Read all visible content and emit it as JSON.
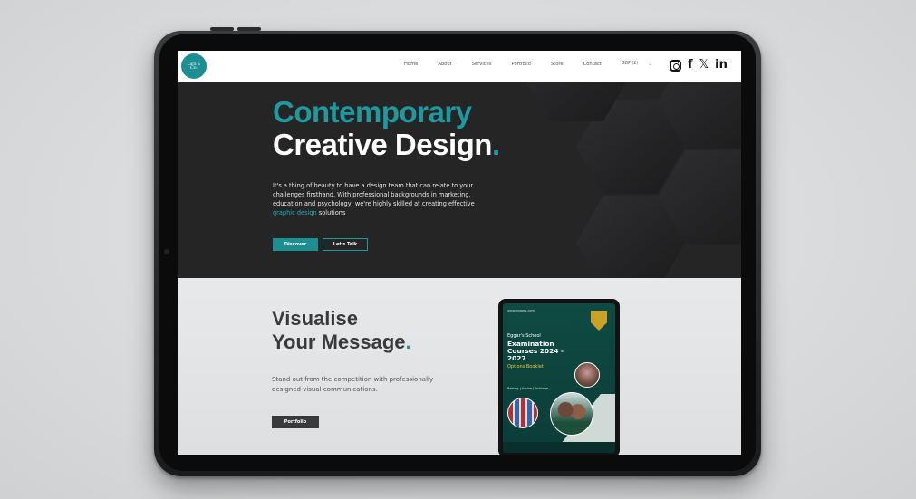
{
  "site": {
    "logo_line1": "Cara &",
    "logo_line2": "Co."
  },
  "nav": {
    "items": [
      "Home",
      "About",
      "Services",
      "Portfolio",
      "Store",
      "Contact"
    ],
    "currency": "GBP (£)",
    "social": [
      "instagram-icon",
      "facebook-icon",
      "x-icon",
      "linkedin-icon"
    ]
  },
  "hero": {
    "title_line1": "Contemporary",
    "title_line2": "Creative Design",
    "title_dot": ".",
    "body_pre": "It's a thing of beauty to have a design team that can relate to your challenges firsthand. With professional backgrounds in marketing, education and psychology, we're highly skilled at creating effective ",
    "body_link": "graphic design",
    "body_post": " solutions",
    "btn_discover": "Discover",
    "btn_talk": "Let's Talk"
  },
  "section2": {
    "title_line1": "Visualise",
    "title_line2": "Your Message",
    "title_dot": ".",
    "body": "Stand out from the competition with professionally designed visual communications.",
    "btn_portfolio": "Portfolio"
  },
  "mockup": {
    "url": "www.eggars.com",
    "school": "Eggar's School",
    "title": "Examination Courses 2024 - 2027",
    "subtitle": "Options Booklet",
    "tagline": "Belong | Aspire | Achieve"
  },
  "colors": {
    "accent": "#1c9aa0",
    "hero_bg": "#252526",
    "section_bg": "#e3e4e5"
  }
}
